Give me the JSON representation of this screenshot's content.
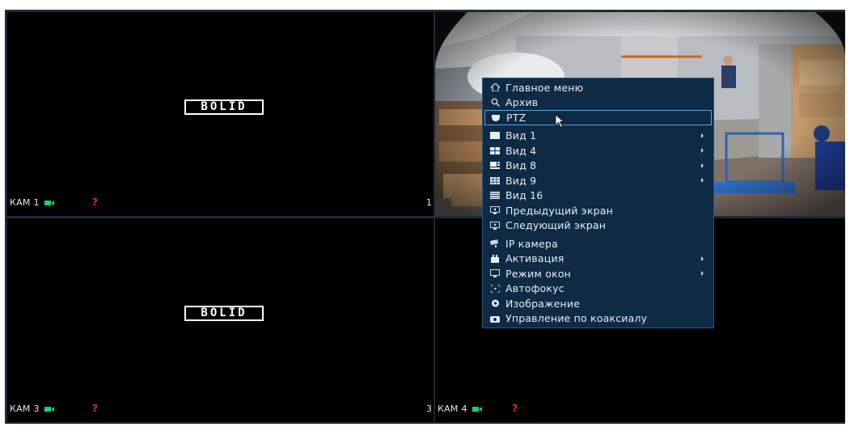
{
  "tiles": [
    {
      "cam_label": "КАМ 1",
      "number": "1",
      "logo_text": "BOLID"
    },
    {
      "cam_label": "",
      "number": "",
      "logo_text": ""
    },
    {
      "cam_label": "КАМ 3",
      "number": "3",
      "logo_text": "BOLID"
    },
    {
      "cam_label": "КАМ 4",
      "number": "",
      "logo_text": ""
    }
  ],
  "warning_glyph": "?",
  "menu": {
    "items": [
      {
        "label": "Главное меню",
        "icon": "home-icon"
      },
      {
        "label": "Архив",
        "icon": "search-icon"
      },
      {
        "label": "PTZ",
        "icon": "ptz-camera-icon",
        "selected": true
      },
      {
        "label": "Вид 1",
        "icon": "layout-1-icon",
        "submenu": true
      },
      {
        "label": "Вид 4",
        "icon": "layout-4-icon",
        "submenu": true
      },
      {
        "label": "Вид 8",
        "icon": "layout-8-icon",
        "submenu": true
      },
      {
        "label": "Вид 9",
        "icon": "layout-9-icon",
        "submenu": true
      },
      {
        "label": "Вид 16",
        "icon": "layout-16-icon"
      },
      {
        "label": "Предыдущий экран",
        "icon": "previous-screen-icon"
      },
      {
        "label": "Следующий экран",
        "icon": "next-screen-icon"
      },
      {
        "label": "IP камера",
        "icon": "ip-camera-icon"
      },
      {
        "label": "Активация",
        "icon": "activation-icon",
        "submenu": true
      },
      {
        "label": "Режим окон",
        "icon": "window-mode-icon",
        "submenu": true
      },
      {
        "label": "Автофокус",
        "icon": "autofocus-icon"
      },
      {
        "label": "Изображение",
        "icon": "image-icon"
      },
      {
        "label": "Управление по коаксиалу",
        "icon": "coax-control-icon"
      }
    ]
  },
  "colors": {
    "menu_bg": "#0e2a44",
    "rec_green": "#1fd06a",
    "warning_red": "#e03030",
    "selection_border": "#5aa7e0"
  }
}
